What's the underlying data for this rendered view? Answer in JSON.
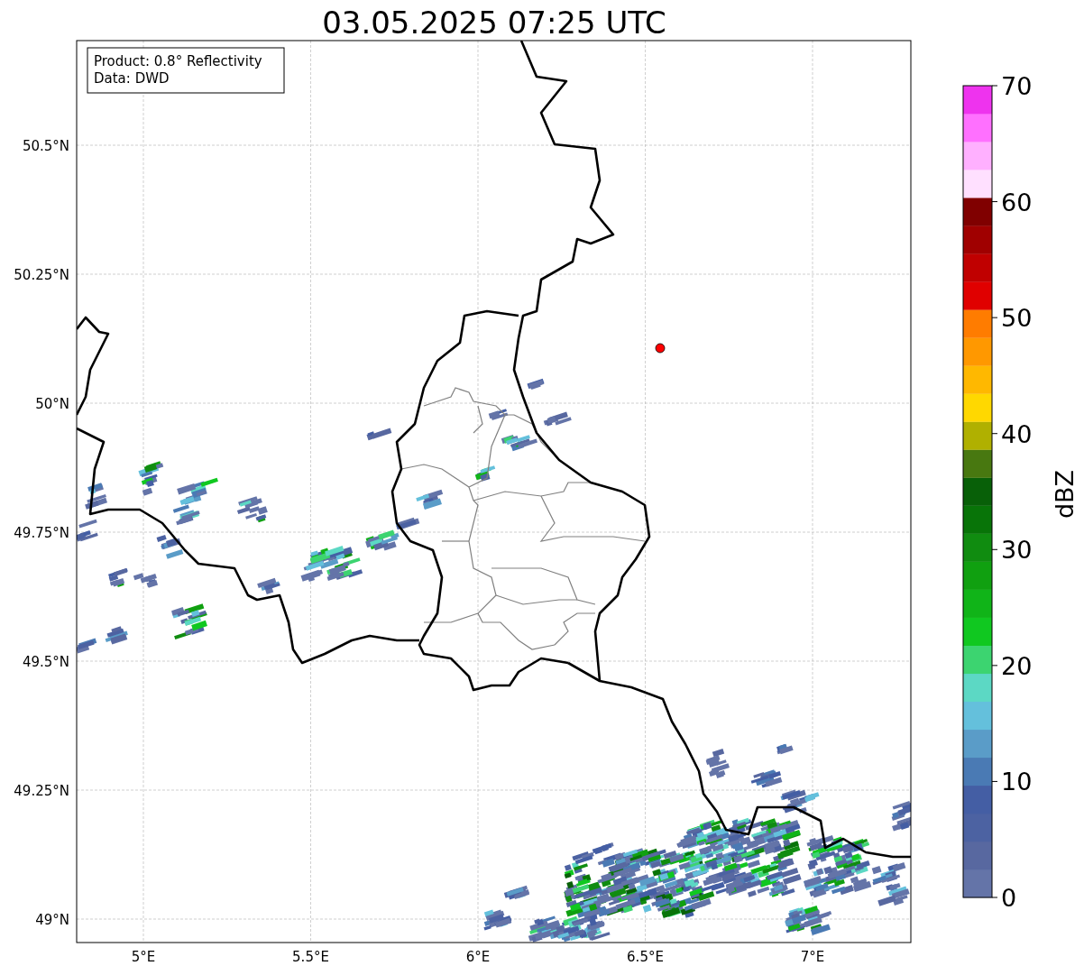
{
  "title": "03.05.2025 07:25 UTC",
  "info_box": [
    "Product: 0.8° Reflectivity",
    "Data: DWD"
  ],
  "latitude_labels": [
    "50.5°N",
    "50.25°N",
    "50°N",
    "49.75°N",
    "49.5°N",
    "49.25°N",
    "49°N"
  ],
  "longitude_labels": [
    "5°E",
    "5.5°E",
    "6°E",
    "6.5°E",
    "7°E"
  ],
  "colorbar": {
    "label": "dBZ",
    "ticks": [
      "70",
      "60",
      "50",
      "40",
      "30",
      "20",
      "10",
      "0"
    ],
    "segments": [
      {
        "color": "#6474a8"
      },
      {
        "color": "#5868a0"
      },
      {
        "color": "#4c62a2"
      },
      {
        "color": "#445ea4"
      },
      {
        "color": "#4a7ab4"
      },
      {
        "color": "#5a9cc8"
      },
      {
        "color": "#64c0dc"
      },
      {
        "color": "#5cd8c4"
      },
      {
        "color": "#3cd470"
      },
      {
        "color": "#10c820"
      },
      {
        "color": "#10b418"
      },
      {
        "color": "#10a010"
      },
      {
        "color": "#108c10"
      },
      {
        "color": "#087408"
      },
      {
        "color": "#086008"
      },
      {
        "color": "#487810"
      },
      {
        "color": "#b0b000"
      },
      {
        "color": "#ffd800"
      },
      {
        "color": "#ffb800"
      },
      {
        "color": "#ff9800"
      },
      {
        "color": "#ff7c00"
      },
      {
        "color": "#e00000"
      },
      {
        "color": "#c00000"
      },
      {
        "color": "#a00000"
      },
      {
        "color": "#800000"
      },
      {
        "color": "#ffe0ff"
      },
      {
        "color": "#ffb0ff"
      },
      {
        "color": "#ff70ff"
      },
      {
        "color": "#ee33ee"
      }
    ]
  }
}
